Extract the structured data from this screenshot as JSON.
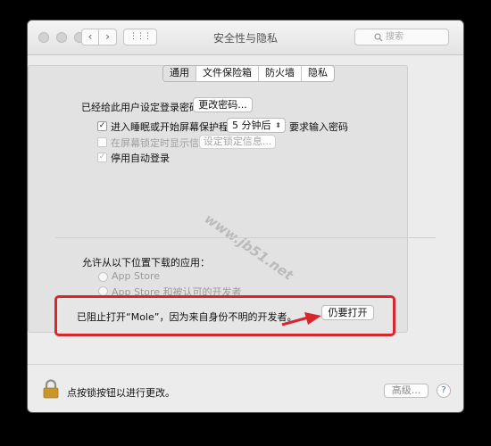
{
  "window": {
    "title": "安全性与隐私"
  },
  "toolbar": {
    "back_glyph": "‹",
    "forward_glyph": "›",
    "grid_glyph": "⋮⋮⋮",
    "search_placeholder": "搜索"
  },
  "tabs": [
    {
      "label": "通用",
      "active": true
    },
    {
      "label": "文件保险箱",
      "active": false
    },
    {
      "label": "防火墙",
      "active": false
    },
    {
      "label": "隐私",
      "active": false
    }
  ],
  "general": {
    "password_set_label": "已经给此用户设定登录密码",
    "change_password_button": "更改密码...",
    "require_password_label": "进入睡眠或开始屏幕保护程序",
    "require_password_delay": "5 分钟后",
    "require_password_suffix": "要求输入密码",
    "show_message_label": "在屏幕锁定时显示信息",
    "set_lock_message_button": "设定锁定信息...",
    "disable_autologin_label": "停用自动登录"
  },
  "downloads": {
    "heading": "允许从以下位置下载的应用：",
    "option_app_store": "App Store",
    "option_identified": "App Store 和被认可的开发者"
  },
  "blocked": {
    "message": "已阻止打开“Mole”，因为来自身份不明的开发者。",
    "open_anyway_button": "仍要打开"
  },
  "footer": {
    "lock_label": "点按锁按钮以进行更改。",
    "advanced_button": "高级...",
    "help_glyph": "?"
  },
  "watermark": "www.jb51.net",
  "colors": {
    "highlight_red": "#d8262d",
    "arrow_red": "#d8262d",
    "lock_gold": "#c9962b"
  }
}
